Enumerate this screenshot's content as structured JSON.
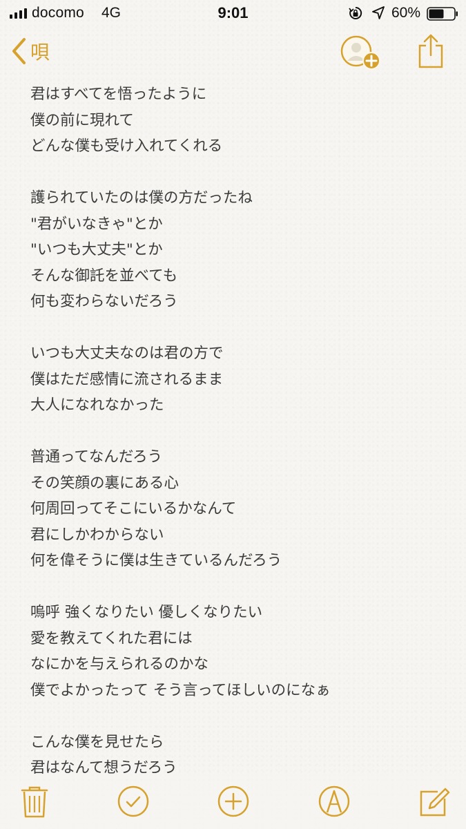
{
  "status_bar": {
    "carrier": "docomo",
    "network": "4G",
    "time": "9:01",
    "battery_percent": "60%",
    "battery_level": 0.6,
    "icons": [
      "signal-icon",
      "rotation-lock-icon",
      "location-arrow-icon",
      "battery-icon"
    ]
  },
  "nav": {
    "back_label": "唄",
    "icons": [
      "chevron-left-icon",
      "add-people-icon",
      "share-icon"
    ]
  },
  "note": {
    "lines": [
      "君はすべてを悟ったように",
      "僕の前に現れて",
      "どんな僕も受け入れてくれる",
      "",
      "護られていたのは僕の方だったね",
      "\"君がいなきゃ\"とか",
      "\"いつも大丈夫\"とか",
      "そんな御託を並べても",
      "何も変わらないだろう",
      "",
      "いつも大丈夫なのは君の方で",
      "僕はただ感情に流されるまま",
      "大人になれなかった",
      "",
      "普通ってなんだろう",
      "その笑顔の裏にある心",
      "何周回ってそこにいるかなんて",
      "君にしかわからない",
      "何を偉そうに僕は生きているんだろう",
      "",
      "嗚呼 強くなりたい 優しくなりたい",
      "愛を教えてくれた君には",
      "なにかを与えられるのかな",
      "僕でよかったって そう言ってほしいのになぁ",
      "",
      "こんな僕を見せたら",
      "君はなんて想うだろう"
    ]
  },
  "toolbar": {
    "icons": [
      "trash-icon",
      "checklist-icon",
      "add-circle-icon",
      "markup-icon",
      "compose-icon"
    ]
  },
  "colors": {
    "accent": "#d6a12d",
    "text": "#3b3b3b",
    "background": "#f6f5f1"
  }
}
